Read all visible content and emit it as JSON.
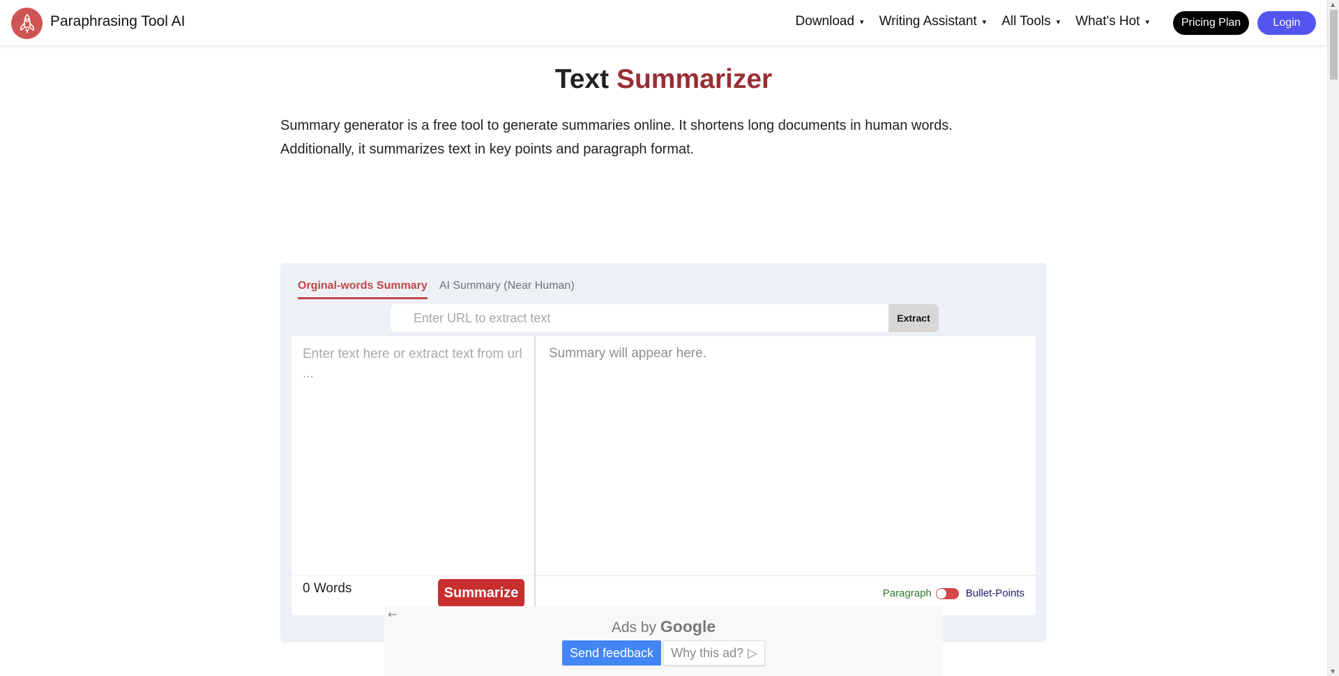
{
  "navbar": {
    "brand": "Paraphrasing Tool AI",
    "links": [
      {
        "label": "Download",
        "caret": "▾"
      },
      {
        "label": "Writing Assistant",
        "caret": "▾"
      },
      {
        "label": "All Tools",
        "caret": "▾"
      },
      {
        "label": "What's Hot",
        "caret": "▾"
      }
    ],
    "pricing_label": "Pricing Plan",
    "login_label": "Login"
  },
  "hero": {
    "title_part1": "Text",
    "title_part2": "Summarizer",
    "description_line1": "Summary generator is a free tool to generate summaries online. It shortens long documents in human words.",
    "description_line2": "Additionally, it summarizes text in key points and paragraph format."
  },
  "tool": {
    "tabs": [
      {
        "label": "Orginal-words Summary",
        "active": true
      },
      {
        "label": "AI Summary (Near Human)",
        "active": false
      }
    ],
    "url_placeholder": "Enter URL to extract text",
    "url_value": "",
    "extract_label": "Extract",
    "input_placeholder": "Enter text here or extract text from url ...",
    "input_value": "",
    "word_count": "0 Words",
    "summarize_label": "Summarize",
    "output_placeholder": "Summary will appear here.",
    "mode_left": "Paragraph",
    "mode_right": "Bullet-Points"
  },
  "ad": {
    "back_icon": "←",
    "ads_by": "Ads by",
    "google": "Google",
    "send_feedback": "Send feedback",
    "why_this_ad": "Why this ad?",
    "why_icon": "▷"
  },
  "colors": {
    "brand_red": "#d15454",
    "title_accent": "#9a2e33",
    "tab_active": "#c0464a",
    "summarize": "#c92f2f",
    "login": "#5454f0",
    "ad_blue": "#4285f4"
  }
}
